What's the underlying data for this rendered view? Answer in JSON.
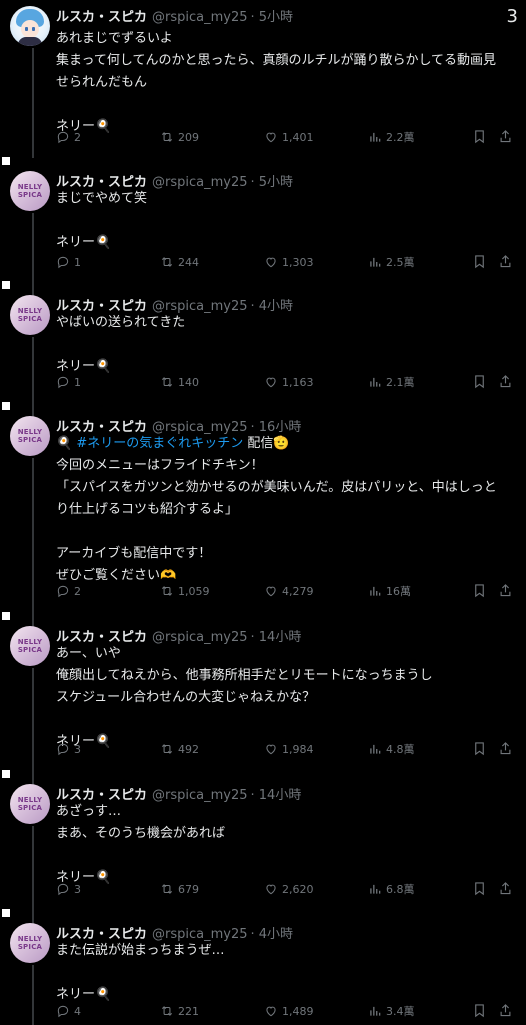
{
  "page_number": "3",
  "tweets": [
    {
      "name": "ルスカ・スピカ",
      "handle": "@rspica_my25",
      "time": "· 5小時",
      "body": "あれまじでずるいよ\n集まって何してんのかと思ったら、真顔のルチルが踊り散らかしてる動画見\nせられんだもん\n\nネリー🍳",
      "replies": "2",
      "retweets": "209",
      "likes": "1,401",
      "views": "2.2萬",
      "avatar": "blue-hair-character"
    },
    {
      "name": "ルスカ・スピカ",
      "handle": "@rspica_my25",
      "time": "· 5小時",
      "body": "まじでやめて笑\n\nネリー🍳",
      "replies": "1",
      "retweets": "244",
      "likes": "1,303",
      "views": "2.5萬",
      "avatar": "nelly-logo"
    },
    {
      "name": "ルスカ・スピカ",
      "handle": "@rspica_my25",
      "time": "· 4小時",
      "body": "やばいの送られてきた\n\nネリー🍳",
      "replies": "1",
      "retweets": "140",
      "likes": "1,163",
      "views": "2.1萬",
      "avatar": "nelly-logo"
    },
    {
      "name": "ルスカ・スピカ",
      "handle": "@rspica_my25",
      "time": "· 16小時",
      "body_prefix": "🍳 ",
      "hashtag": "#ネリーの気まぐれキッチン",
      "body_suffix": " 配信🫡",
      "body": "\n今回のメニューはフライドチキン！\n「スパイスをガツンと効かせるのが美味いんだ。皮はパリッと、中はしっと\nり仕上げるコツも紹介するよ」\n\nアーカイブも配信中です！\nぜひご覧ください🫶",
      "replies": "2",
      "retweets": "1,059",
      "likes": "4,279",
      "views": "16萬",
      "avatar": "nelly-logo"
    },
    {
      "name": "ルスカ・スピカ",
      "handle": "@rspica_my25",
      "time": "· 14小時",
      "body": "あー、いや\n俺顔出してねえから、他事務所相手だとリモートになっちまうし\nスケジュール合わせんの大変じゃねえかな？\n\nネリー🍳",
      "replies": "3",
      "retweets": "492",
      "likes": "1,984",
      "views": "4.8萬",
      "avatar": "nelly-logo"
    },
    {
      "name": "ルスカ・スピカ",
      "handle": "@rspica_my25",
      "time": "· 14小時",
      "body": "あざっす…\nまあ、そのうち機会があれば\n\nネリー🍳",
      "replies": "3",
      "retweets": "679",
      "likes": "2,620",
      "views": "6.8萬",
      "avatar": "nelly-logo"
    },
    {
      "name": "ルスカ・スピカ",
      "handle": "@rspica_my25",
      "time": "· 4小時",
      "body": "また伝説が始まっちまうぜ…\n\nネリー🍳",
      "replies": "4",
      "retweets": "221",
      "likes": "1,489",
      "views": "3.4萬",
      "avatar": "nelly-logo"
    }
  ],
  "avatar_logo_text": "NELLY\nSPICA",
  "colors": {
    "background": "#000000",
    "text": "#e7e9ea",
    "muted": "#71767b",
    "link": "#1d9bf0"
  }
}
